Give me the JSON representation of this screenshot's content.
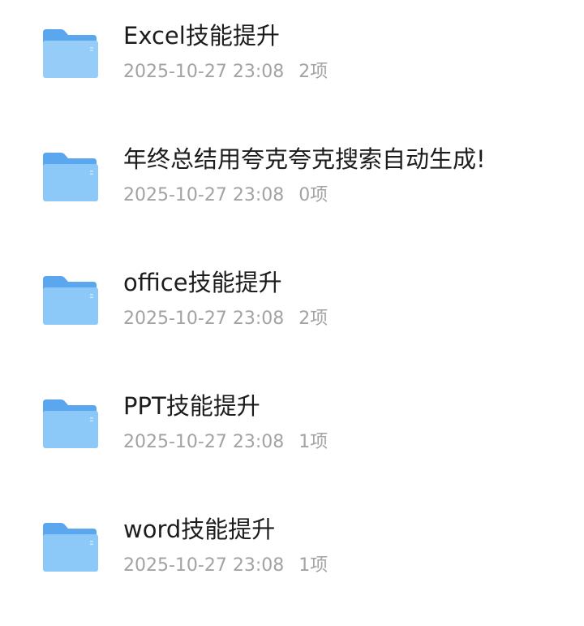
{
  "files": [
    {
      "name": "Excel技能提升",
      "date": "2025-10-27 23:08",
      "count": "2项"
    },
    {
      "name": "年终总结用夸克夸克搜索自动生成!",
      "date": "2025-10-27 23:08",
      "count": "0项"
    },
    {
      "name": "office技能提升",
      "date": "2025-10-27 23:08",
      "count": "2项"
    },
    {
      "name": "PPT技能提升",
      "date": "2025-10-27 23:08",
      "count": "1项"
    },
    {
      "name": "word技能提升",
      "date": "2025-10-27 23:08",
      "count": "1项"
    }
  ],
  "colors": {
    "folder_back": "#5aa7f0",
    "folder_front": "#8cc8f8",
    "title_text": "#1c1c1c",
    "meta_text": "#a3a3a3"
  },
  "icons": {
    "folder": "folder-icon"
  }
}
